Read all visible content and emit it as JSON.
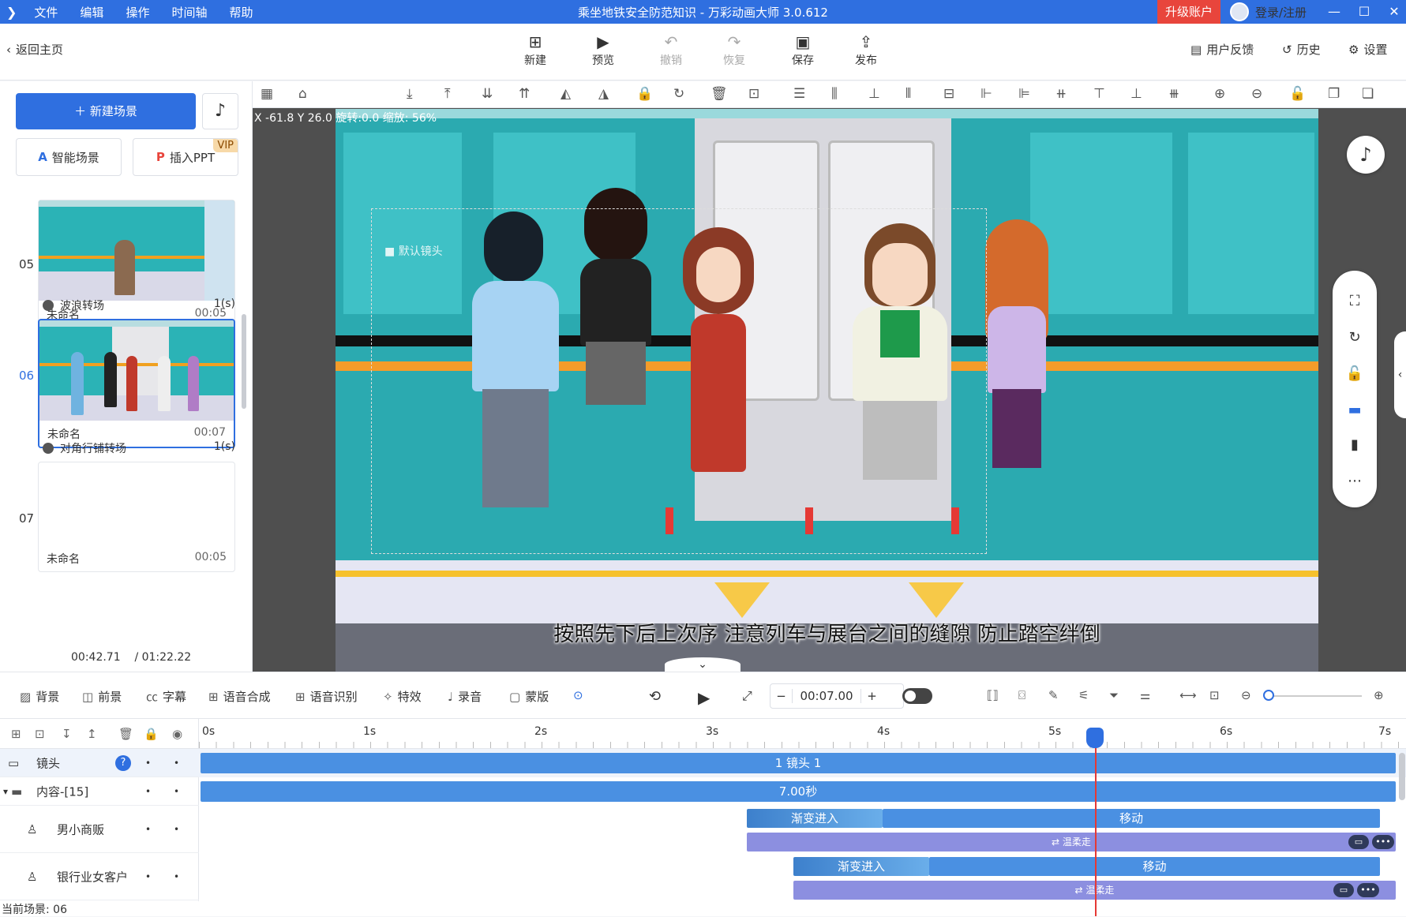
{
  "titlebar": {
    "menus": [
      "文件",
      "编辑",
      "操作",
      "时间轴",
      "帮助"
    ],
    "title": "乘坐地铁安全防范知识 - 万彩动画大师 3.0.612",
    "upgrade": "升级账户",
    "login": "登录/注册"
  },
  "toolbar": {
    "back": "返回主页",
    "new": "新建",
    "preview": "预览",
    "undo": "撤销",
    "redo": "恢复",
    "save": "保存",
    "publish": "发布",
    "feedback": "用户反馈",
    "history": "历史",
    "settings": "设置"
  },
  "left": {
    "new_scene": "新建场景",
    "smart_scene": "智能场景",
    "insert_ppt": "插入PPT",
    "vip": "VIP",
    "scenes": [
      {
        "num": "05",
        "name": "未命名",
        "duration": "00:05"
      },
      {
        "num": "06",
        "name": "未命名",
        "duration": "00:07"
      },
      {
        "num": "07",
        "name": "未命名",
        "duration": "00:05"
      }
    ],
    "transitions": [
      {
        "name": "波浪转场",
        "duration": "1(s)"
      },
      {
        "name": "对角行铺转场",
        "duration": "1(s)"
      }
    ],
    "current_time": "00:42.71",
    "total_time": "/ 01:22.22"
  },
  "canvas": {
    "coords": "X -61.8 Y 26.0 旋转:0.0 缩放: 56%",
    "camera_label": "默认镜头",
    "subtitle": "按照先下后上次序 注意列车与展台之间的缝隙 防止踏空绊倒"
  },
  "timeline_controls": {
    "background": "背景",
    "foreground": "前景",
    "caption": "字幕",
    "tts": "语音合成",
    "asr": "语音识别",
    "effects": "特效",
    "record": "录音",
    "mask": "蒙版",
    "time": "00:07.00"
  },
  "timeline": {
    "ticks": [
      "0s",
      "1s",
      "2s",
      "3s",
      "4s",
      "5s",
      "6s",
      "7s"
    ],
    "rows": [
      {
        "name": "镜头",
        "bar": "1 镜头 1"
      },
      {
        "name": "内容-[15]",
        "bar": "7.00秒"
      },
      {
        "name": "男小商贩",
        "enter": "渐变进入",
        "move": "移动",
        "sub": "温柔走"
      },
      {
        "name": "银行业女客户",
        "enter": "渐变进入",
        "move": "移动",
        "sub": "温柔走"
      }
    ],
    "status": "当前场景: 06"
  },
  "colors": {
    "accent": "#2f6fe0",
    "upgrade": "#e8453c",
    "bar_blue": "#4a90e2",
    "bar_purple": "#8c8fe0",
    "playhead": "#e53935"
  }
}
